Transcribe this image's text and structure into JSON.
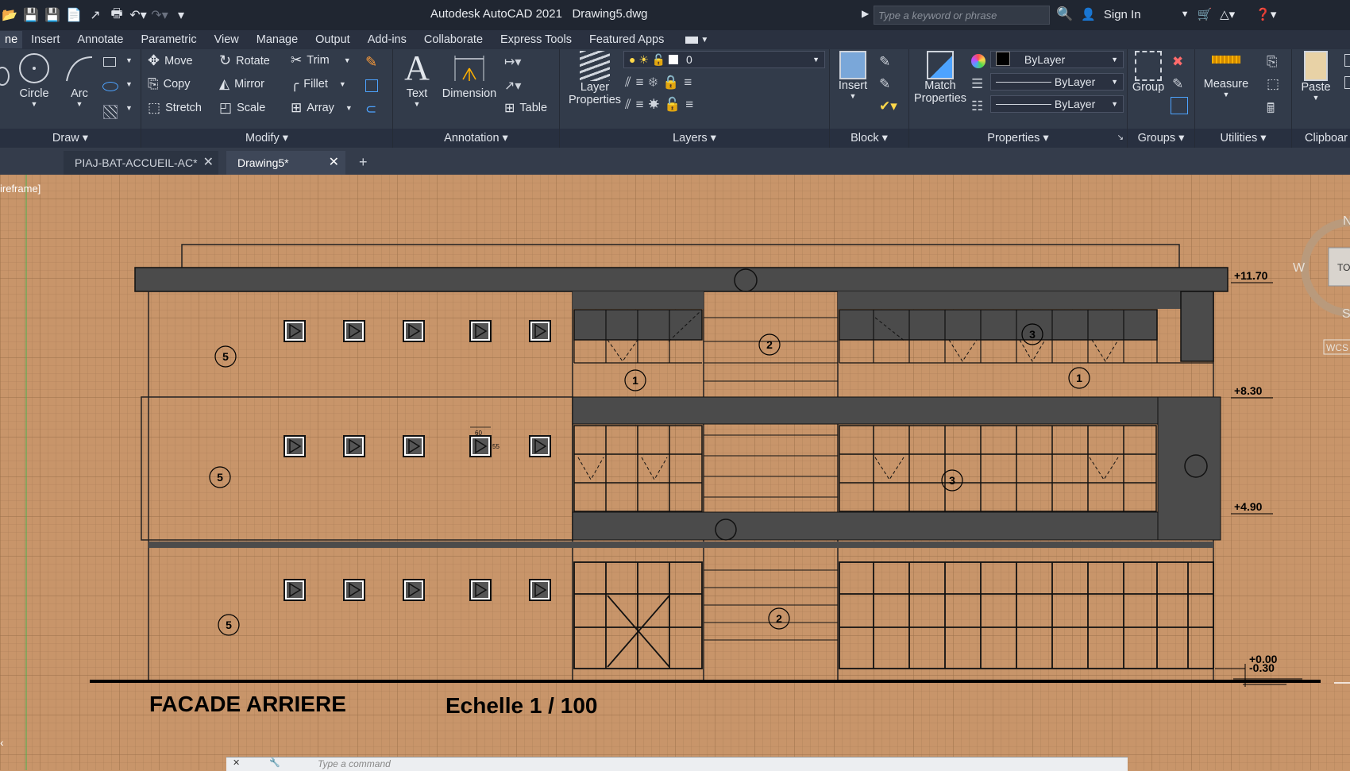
{
  "title": {
    "app": "Autodesk AutoCAD 2021",
    "file": "Drawing5.dwg"
  },
  "search": {
    "placeholder": "Type a keyword or phrase"
  },
  "account": {
    "sign_in": "Sign In"
  },
  "menu": [
    "ne",
    "Insert",
    "Annotate",
    "Parametric",
    "View",
    "Manage",
    "Output",
    "Add-ins",
    "Collaborate",
    "Express Tools",
    "Featured Apps"
  ],
  "ribbon": {
    "draw": {
      "label": "Draw",
      "circle": "Circle",
      "arc": "Arc"
    },
    "modify": {
      "label": "Modify",
      "move": "Move",
      "rotate": "Rotate",
      "trim": "Trim",
      "copy": "Copy",
      "mirror": "Mirror",
      "fillet": "Fillet",
      "stretch": "Stretch",
      "scale": "Scale",
      "array": "Array"
    },
    "annotation": {
      "label": "Annotation",
      "text": "Text",
      "dimension": "Dimension",
      "table": "Table"
    },
    "layers": {
      "label": "Layers",
      "layer_properties_1": "Layer",
      "layer_properties_2": "Properties",
      "current_layer": "0"
    },
    "block": {
      "label": "Block",
      "insert": "Insert"
    },
    "properties": {
      "label": "Properties",
      "match_1": "Match",
      "match_2": "Properties",
      "color": "ByLayer",
      "linetype": "ByLayer",
      "lineweight": "ByLayer"
    },
    "groups": {
      "label": "Groups",
      "group": "Group"
    },
    "utilities": {
      "label": "Utilities",
      "measure": "Measure"
    },
    "clipboard": {
      "label": "Clipboar",
      "paste": "Paste"
    }
  },
  "tabs": [
    {
      "label": "PIAJ-BAT-ACCUEIL-AC*"
    },
    {
      "label": "Drawing5*"
    }
  ],
  "viewport": {
    "label": "ireframe]"
  },
  "drawing": {
    "title": "FACADE ARRIERE",
    "scale": "Echelle 1 / 100",
    "levels": [
      "+11.70",
      "+8.30",
      "+4.90",
      "+0.00",
      "-0.30"
    ],
    "tags": [
      "5",
      "5",
      "5",
      "1",
      "1",
      "2",
      "2",
      "3",
      "3"
    ],
    "dims": [
      "60",
      "55"
    ]
  },
  "viewcube": {
    "north": "N",
    "west": "W",
    "south": "S",
    "top": "TO",
    "wcs": "WCS"
  },
  "command": {
    "placeholder": "Type a command"
  },
  "colors": {
    "background": "#c8956a",
    "ribbon": "#323b4a",
    "titlebar": "#202631",
    "dark_band": "#4b4b4b"
  }
}
